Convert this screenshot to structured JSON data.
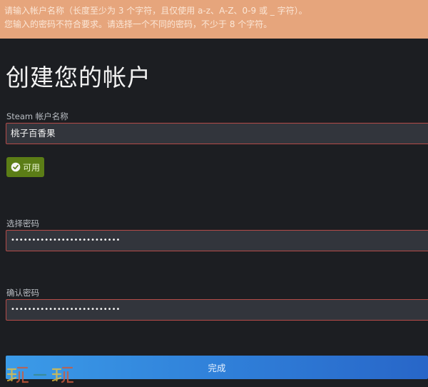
{
  "error_banner": {
    "line1": "请输入帐户名称（长度至少为 3 个字符，且仅使用 a-z、A-Z、0-9 或 _ 字符）。",
    "line2": "您输入的密码不符合要求。请选择一个不同的密码，不少于 8 个字符。"
  },
  "page_title": "创建您的帐户",
  "account_name": {
    "label": "Steam 帐户名称",
    "value": "桃子百香果"
  },
  "availability_badge": {
    "icon": "check-circle-icon",
    "label": "可用"
  },
  "password": {
    "label": "选择密码",
    "value": "••••••••••••••••••••••••••"
  },
  "confirm_password": {
    "label": "确认密码",
    "value": "••••••••••••••••••••••••••"
  },
  "done_button": {
    "label": "完成"
  },
  "colors": {
    "error_banner_bg": "#e6a57c",
    "page_bg": "#1c1e22",
    "field_bg": "#32353c",
    "field_error_border": "#b44b48",
    "available_green": "#5b7d16",
    "button_blue": "#2f7ed8"
  }
}
